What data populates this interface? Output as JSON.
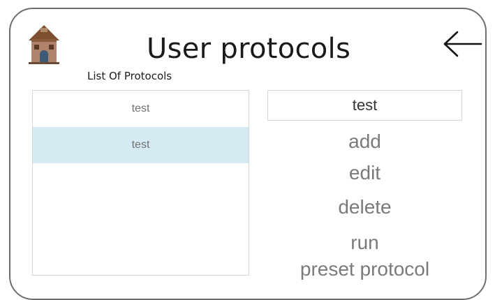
{
  "header": {
    "title": "User protocols",
    "home_icon": "home-icon",
    "back_icon": "arrow-left-icon"
  },
  "protocols": {
    "heading": "List Of Protocols",
    "items": [
      {
        "label": "test",
        "selected": false
      },
      {
        "label": "test",
        "selected": true
      }
    ]
  },
  "editor": {
    "name_value": "test"
  },
  "actions": {
    "add": "add",
    "edit": "edit",
    "delete": "delete",
    "run_line1": "run",
    "run_line2": "preset protocol"
  },
  "colors": {
    "selected_row": "#d6eaf3",
    "frame_border": "#6e6e6e",
    "action_text": "#7a7a7a"
  }
}
